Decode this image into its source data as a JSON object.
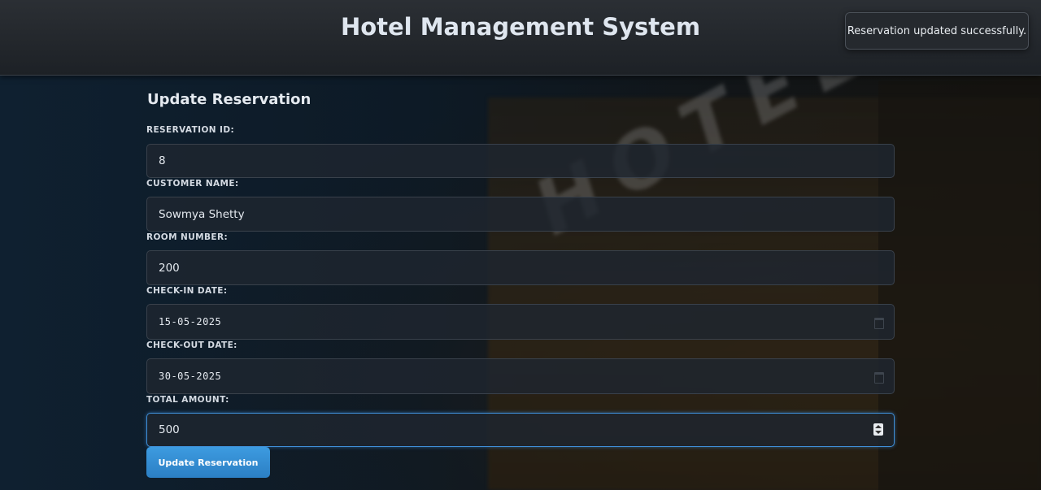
{
  "header": {
    "title": "Hotel Management System"
  },
  "toast": {
    "message": "Reservation updated successfully."
  },
  "form": {
    "title": "Update Reservation",
    "fields": {
      "reservation_id": {
        "label": "RESERVATION ID:",
        "value": "8"
      },
      "customer_name": {
        "label": "CUSTOMER NAME:",
        "value": "Sowmya Shetty"
      },
      "room_number": {
        "label": "ROOM NUMBER:",
        "value": "200"
      },
      "check_in": {
        "label": "CHECK-IN DATE:",
        "value": "15-05-2025",
        "icon": "calendar-icon"
      },
      "check_out": {
        "label": "CHECK-OUT DATE:",
        "value": "30-05-2025",
        "icon": "calendar-icon"
      },
      "total_amount": {
        "label": "TOTAL AMOUNT:",
        "value": "500",
        "icon": "number-spinner-icon"
      }
    },
    "submit_label": "Update Reservation"
  },
  "background": {
    "sign_text": "HOTEL"
  },
  "colors": {
    "accent": "#3d9be0",
    "header_bg": "#23272c",
    "field_bg": "#1f2630"
  }
}
